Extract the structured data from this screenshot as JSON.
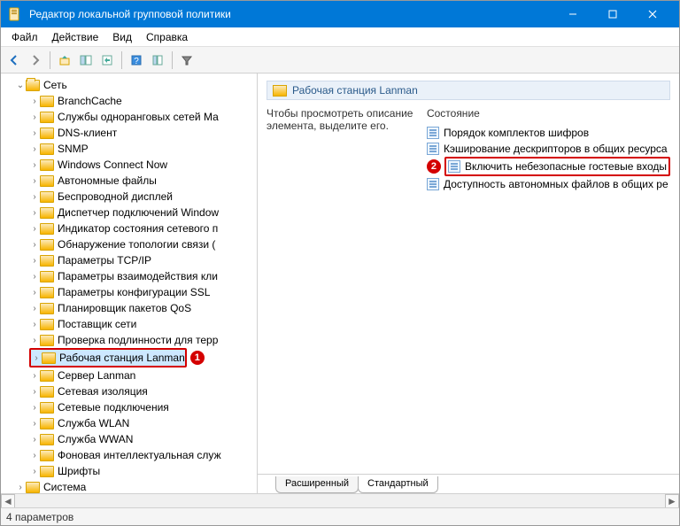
{
  "window": {
    "title": "Редактор локальной групповой политики"
  },
  "menu": {
    "file": "Файл",
    "action": "Действие",
    "view": "Вид",
    "help": "Справка"
  },
  "tree": {
    "root": {
      "label": "Сеть",
      "expanded": true
    },
    "items": [
      "BranchCache",
      "Службы одноранговых сетей Ма",
      "DNS-клиент",
      "SNMP",
      "Windows Connect Now",
      "Автономные файлы",
      "Беспроводной дисплей",
      "Диспетчер подключений Window",
      "Индикатор состояния сетевого п",
      "Обнаружение топологии связи (",
      "Параметры TCP/IP",
      "Параметры взаимодействия кли",
      "Параметры конфигурации SSL",
      "Планировщик пакетов QoS",
      "Поставщик сети",
      "Проверка подлинности для терр",
      "Рабочая станция Lanman",
      "Сервер Lanman",
      "Сетевая изоляция",
      "Сетевые подключения",
      "Служба WLAN",
      "Служба WWAN",
      "Фоновая интеллектуальная служ",
      "Шрифты"
    ],
    "after_root": {
      "label": "Система"
    },
    "selected_index": 16,
    "badge1": "1"
  },
  "right": {
    "header": "Рабочая станция Lanman",
    "description": "Чтобы просмотреть описание элемента, выделите его.",
    "column_header": "Состояние",
    "settings": [
      "Порядок комплектов шифров",
      "Кэширование дескрипторов в общих ресурса",
      "Включить небезопасные гостевые входы",
      "Доступность автономных файлов в общих ре"
    ],
    "highlight_index": 2,
    "badge2": "2"
  },
  "tabs": {
    "extended": "Расширенный",
    "standard": "Стандартный",
    "active": "standard"
  },
  "status": {
    "text": "4 параметров"
  }
}
